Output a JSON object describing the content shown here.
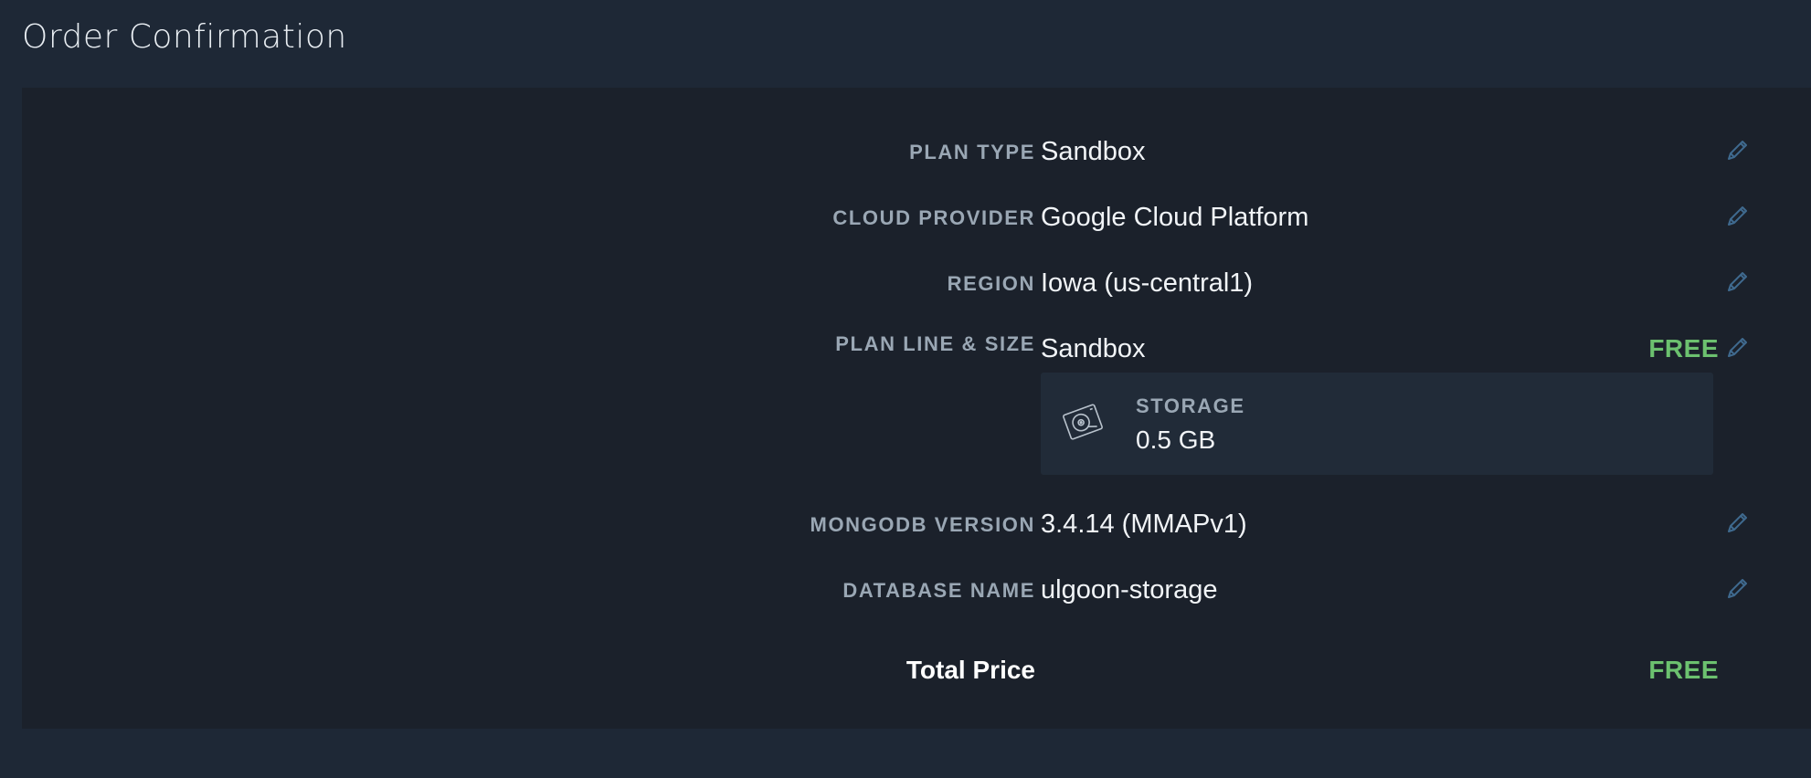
{
  "page": {
    "title": "Order Confirmation"
  },
  "rows": {
    "plan_type": {
      "label": "PLAN TYPE",
      "value": "Sandbox"
    },
    "cloud_provider": {
      "label": "CLOUD PROVIDER",
      "value": "Google Cloud Platform"
    },
    "region": {
      "label": "REGION",
      "value": "Iowa (us-central1)"
    },
    "plan_line_size": {
      "label": "PLAN LINE & SIZE",
      "value": "Sandbox",
      "price": "FREE"
    },
    "mongodb_version": {
      "label": "MONGODB VERSION",
      "value": "3.4.14 (MMAPv1)"
    },
    "database_name": {
      "label": "DATABASE NAME",
      "value": "ulgoon-storage"
    }
  },
  "storage": {
    "label": "STORAGE",
    "value": "0.5 GB",
    "icon": "hard-drive-icon"
  },
  "total": {
    "label": "Total Price",
    "value": "FREE"
  },
  "icons": {
    "edit": "pencil-icon"
  },
  "colors": {
    "background": "#1e2836",
    "panel": "#1b212b",
    "free_green": "#6cc16f",
    "label_gray": "#9aa7b4",
    "edit_blue": "#3f6a8f"
  }
}
